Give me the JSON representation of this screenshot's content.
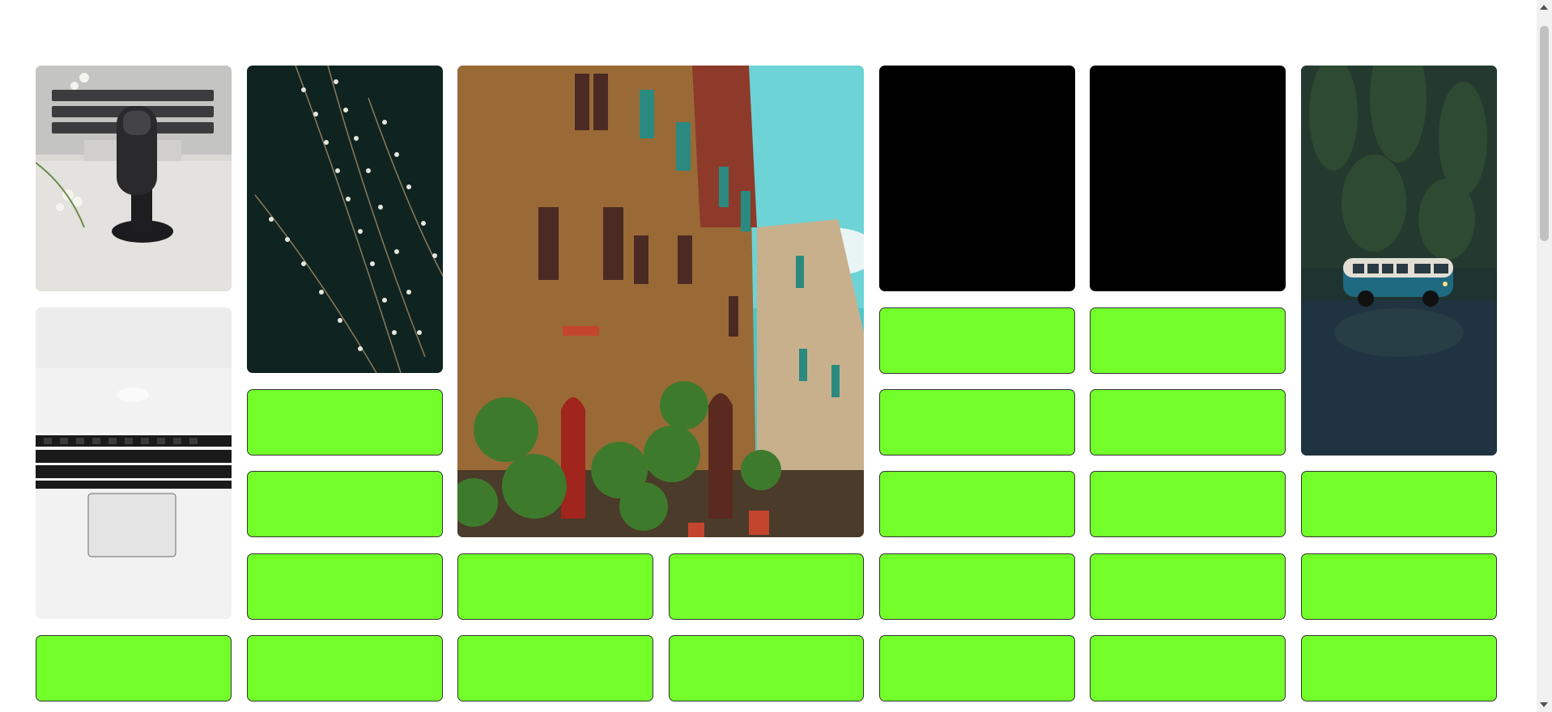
{
  "theme": {
    "background": "#ffffff",
    "green": "#72ff2a",
    "black": "#000000"
  },
  "images": {
    "microphone": {
      "icon": "photo-microphone-on-laptop"
    },
    "willow": {
      "icon": "photo-willow-branches"
    },
    "building": {
      "icon": "photo-italian-street-building"
    },
    "van": {
      "icon": "photo-toy-vw-van"
    },
    "laptop": {
      "icon": "photo-laptop-keyboard"
    }
  },
  "scrollbar": {
    "thumb_fraction": 0.34
  }
}
